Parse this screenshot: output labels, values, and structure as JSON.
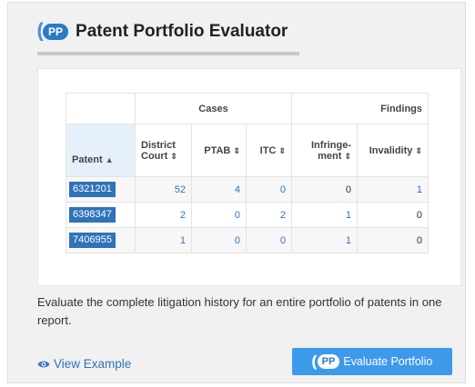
{
  "header": {
    "logo_text": "PP",
    "title": "Patent Portfolio Evaluator"
  },
  "table": {
    "groups": {
      "cases": "Cases",
      "findings": "Findings"
    },
    "columns": {
      "patent": "Patent",
      "district_court": "District Court",
      "ptab": "PTAB",
      "itc": "ITC",
      "infringement": "Infringe- ment",
      "invalidity": "Invalidity"
    },
    "rows": [
      {
        "patent": "6321201",
        "district_court": "52",
        "ptab": "4",
        "itc": "0",
        "infringement": "0",
        "invalidity": "1"
      },
      {
        "patent": "6398347",
        "district_court": "2",
        "ptab": "0",
        "itc": "2",
        "infringement": "1",
        "invalidity": "0"
      },
      {
        "patent": "7406955",
        "district_court": "1",
        "ptab": "0",
        "itc": "0",
        "infringement": "1",
        "invalidity": "0"
      }
    ]
  },
  "description": "Evaluate the complete litigation history for an entire portfolio of patents in one report.",
  "actions": {
    "view_example": "View Example",
    "evaluate_logo": "PP",
    "evaluate_portfolio": "Evaluate Portfolio"
  },
  "colors": {
    "accent": "#2f73b8",
    "button": "#3d9aeb"
  }
}
